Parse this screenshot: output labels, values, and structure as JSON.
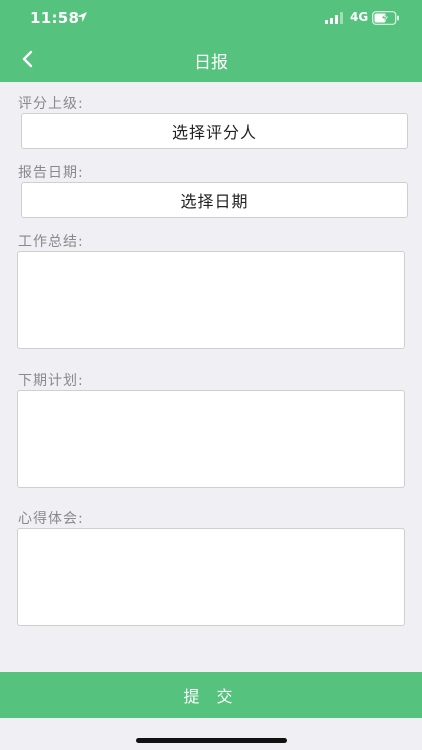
{
  "status_bar": {
    "time": "11:58",
    "network": "4G"
  },
  "nav": {
    "title": "日报",
    "back_icon": "chevron-left-icon"
  },
  "form": {
    "rater_label": "评分上级:",
    "rater_button": "选择评分人",
    "date_label": "报告日期:",
    "date_button": "选择日期",
    "summary_label": "工作总结:",
    "summary_value": "",
    "plan_label": "下期计划:",
    "plan_value": "",
    "reflection_label": "心得体会:",
    "reflection_value": ""
  },
  "submit_label": "提 交",
  "colors": {
    "brand_green": "#55c27d",
    "background": "#efeff4",
    "label_gray": "#8a8a8a"
  }
}
